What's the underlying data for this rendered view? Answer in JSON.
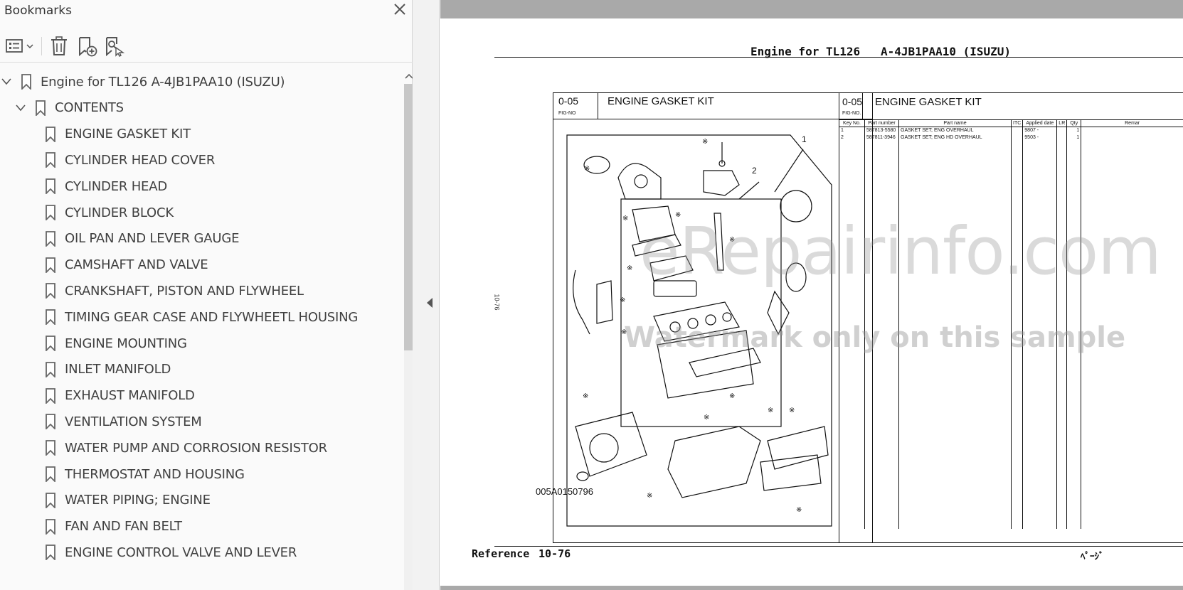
{
  "panel": {
    "title": "Bookmarks",
    "close_icon": "close-icon",
    "toolbar": {
      "options_icon": "list-options-icon",
      "delete_icon": "trash-icon",
      "add_icon": "new-bookmark-icon",
      "find_icon": "find-bookmark-icon"
    }
  },
  "bookmarks": [
    {
      "label": "Engine for TL126 A-4JB1PAA10 (ISUZU)",
      "level": 0,
      "expanded": true
    },
    {
      "label": "CONTENTS",
      "level": 1,
      "expanded": true
    },
    {
      "label": "ENGINE GASKET KIT",
      "level": 2
    },
    {
      "label": "CYLINDER HEAD COVER",
      "level": 2
    },
    {
      "label": "CYLINDER HEAD",
      "level": 2
    },
    {
      "label": "CYLINDER BLOCK",
      "level": 2
    },
    {
      "label": "OIL PAN AND LEVER GAUGE",
      "level": 2
    },
    {
      "label": "CAMSHAFT AND VALVE",
      "level": 2
    },
    {
      "label": "CRANKSHAFT, PISTON AND FLYWHEEL",
      "level": 2
    },
    {
      "label": "TIMING GEAR CASE AND FLYWHEETL HOUSING",
      "level": 2
    },
    {
      "label": "ENGINE MOUNTING",
      "level": 2
    },
    {
      "label": "INLET MANIFOLD",
      "level": 2
    },
    {
      "label": "EXHAUST MANIFOLD",
      "level": 2
    },
    {
      "label": "VENTILATION SYSTEM",
      "level": 2
    },
    {
      "label": "WATER PUMP AND CORROSION RESISTOR",
      "level": 2
    },
    {
      "label": "THERMOSTAT AND HOUSING",
      "level": 2
    },
    {
      "label": "WATER PIPING; ENGINE",
      "level": 2
    },
    {
      "label": "FAN AND FAN BELT",
      "level": 2
    },
    {
      "label": "ENGINE CONTROL VALVE AND LEVER",
      "level": 2
    }
  ],
  "document": {
    "title": "Engine for TL126   A-4JB1PAA10 (ISUZU)",
    "figure": {
      "fig_no": "0-05",
      "fig_label": "FIG-NO",
      "title": "ENGINE GASKET KIT",
      "callouts": [
        "1",
        "2"
      ],
      "illustration_code": "005A0150796"
    },
    "table": {
      "fig_no": "0-05",
      "fig_label": "FIG-NO.",
      "title": "ENGINE GASKET KIT",
      "columns": [
        "Key No.",
        "Part number",
        "Part name",
        "ITC",
        "Applied date",
        "LR",
        "Qty",
        "Remar"
      ],
      "rows": [
        [
          "1",
          "587813-5580",
          "GASKET SET; ENG OVERHAUL",
          "",
          "9807 -",
          "",
          "1",
          ""
        ],
        [
          "2",
          "587811-3946",
          "GASKET SET; ENG HD OVERHAUL",
          "",
          "9503 -",
          "",
          "1",
          ""
        ]
      ]
    },
    "side_number": "10-76",
    "reference_label": "Reference",
    "reference_page": "10-76",
    "page_suffix": "ﾍﾟｰｼﾞ"
  },
  "watermark": {
    "line1": "eRepairinfo.com",
    "line2": "Watermark only on this sample"
  }
}
